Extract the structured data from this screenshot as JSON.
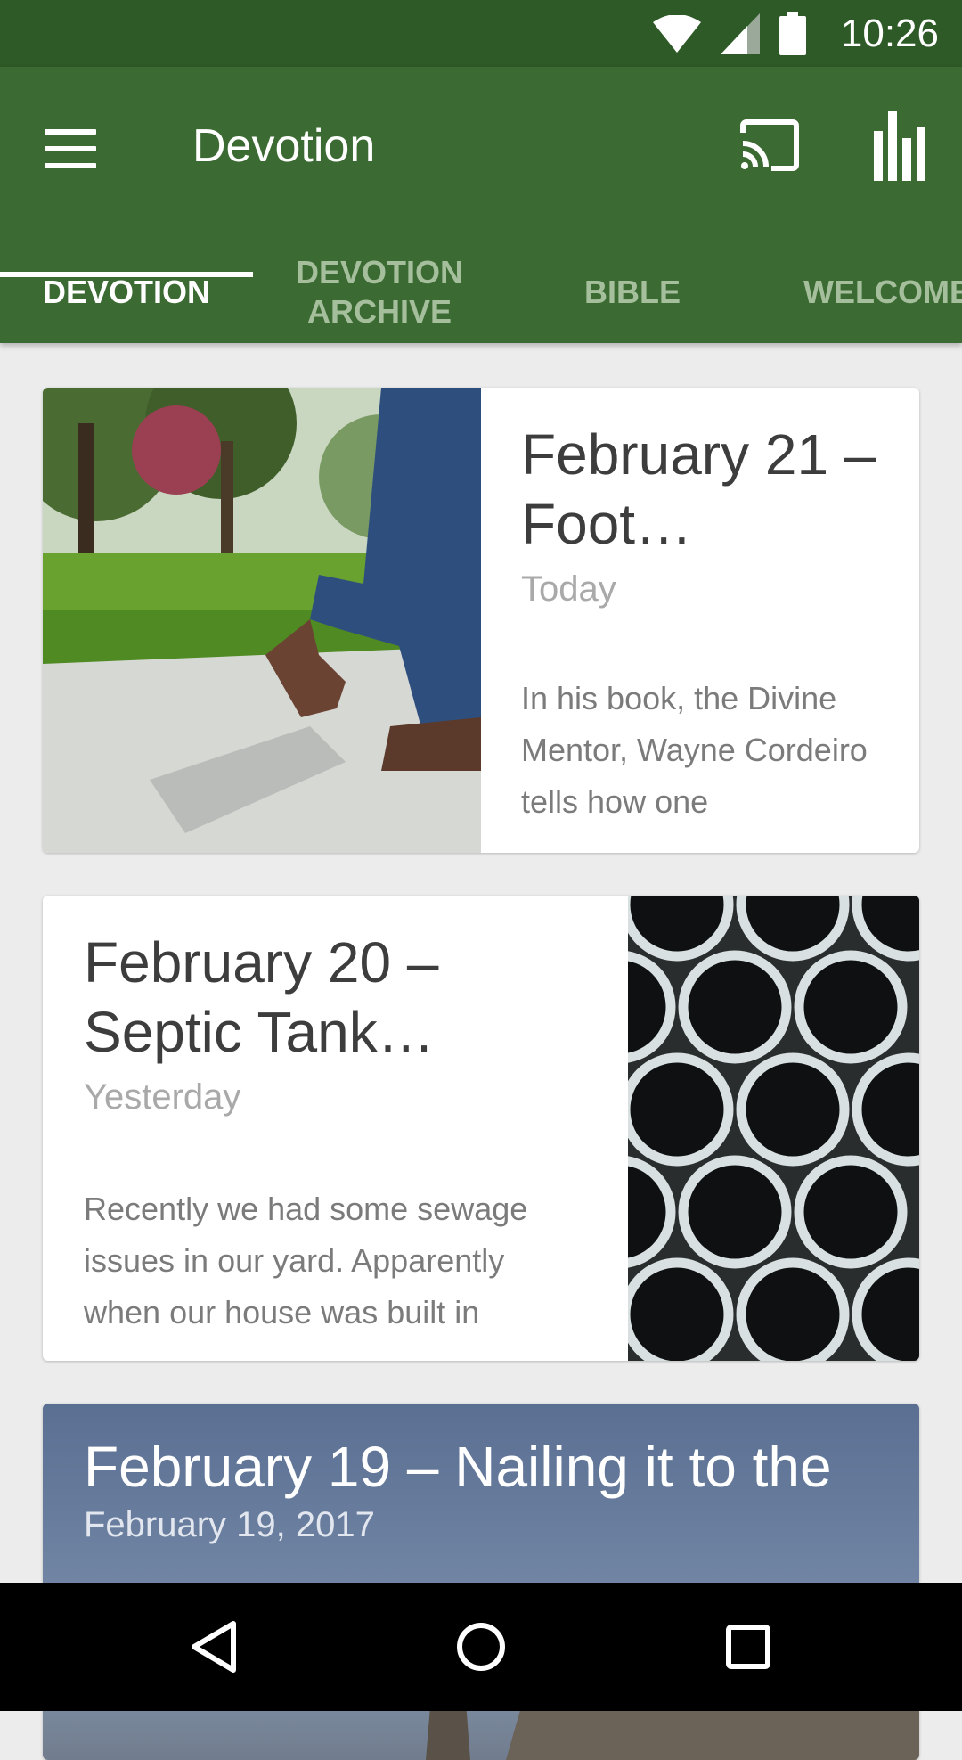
{
  "status_bar": {
    "time": "10:26",
    "icons": [
      "wifi-icon",
      "cell-signal-icon",
      "battery-icon"
    ]
  },
  "app_bar": {
    "title": "Devotion",
    "menu_icon": "menu-icon",
    "actions": [
      "cast-icon",
      "bar-chart-icon"
    ]
  },
  "tabs": [
    {
      "label": "DEVOTION",
      "active": true
    },
    {
      "label": "DEVOTION ARCHIVE",
      "active": false
    },
    {
      "label": "BIBLE",
      "active": false
    },
    {
      "label": "WELCOME",
      "active": false
    }
  ],
  "cards": [
    {
      "title": "February 21 – Foot…",
      "date": "Today",
      "excerpt": "In his book, the Divine Mentor, Wayne Cordeiro tells how one"
    },
    {
      "title": "February 20 – Septic Tank…",
      "date": "Yesterday",
      "excerpt": "Recently we had some sewage issues in our yard.  Apparently when our house was built in"
    },
    {
      "title": "February 19 – Nailing it to the",
      "date": "February 19, 2017"
    }
  ],
  "nav_bar": {
    "buttons": [
      "back-icon",
      "home-icon",
      "recents-icon"
    ]
  },
  "colors": {
    "status_bar": "#2e5a27",
    "app_bar": "#3b6a32",
    "inactive_tab": "#a5bf9c",
    "background": "#ececec"
  }
}
